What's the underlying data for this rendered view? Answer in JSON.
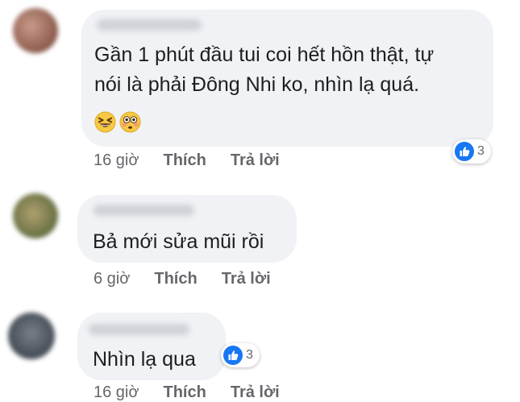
{
  "comments": [
    {
      "text_lines": [
        "Gần 1 phút đầu tui coi hết hồn thật, tự",
        "nói là phải Đông Nhi ko, nhìn lạ quá."
      ],
      "emojis": [
        "laughing-squint-emoji",
        "flushed-emoji"
      ],
      "time": "16 giờ",
      "like_label": "Thích",
      "reply_label": "Trả lời",
      "reaction_count": "3",
      "avatar_color": "#9b6a5c"
    },
    {
      "text_lines": [
        "Bả mới sửa mũi rồi"
      ],
      "time": "6 giờ",
      "like_label": "Thích",
      "reply_label": "Trả lời",
      "avatar_color": "#6f7a52"
    },
    {
      "text_lines": [
        "Nhìn lạ qua"
      ],
      "time": "16 giờ",
      "like_label": "Thích",
      "reply_label": "Trả lời",
      "reaction_count": "3",
      "avatar_color": "#4d5560"
    }
  ],
  "colors": {
    "bubble": "#f0f2f5",
    "like_blue": "#1877f2",
    "meta_gray": "#65676b"
  },
  "icons": {
    "reaction": "like-thumb-icon"
  }
}
